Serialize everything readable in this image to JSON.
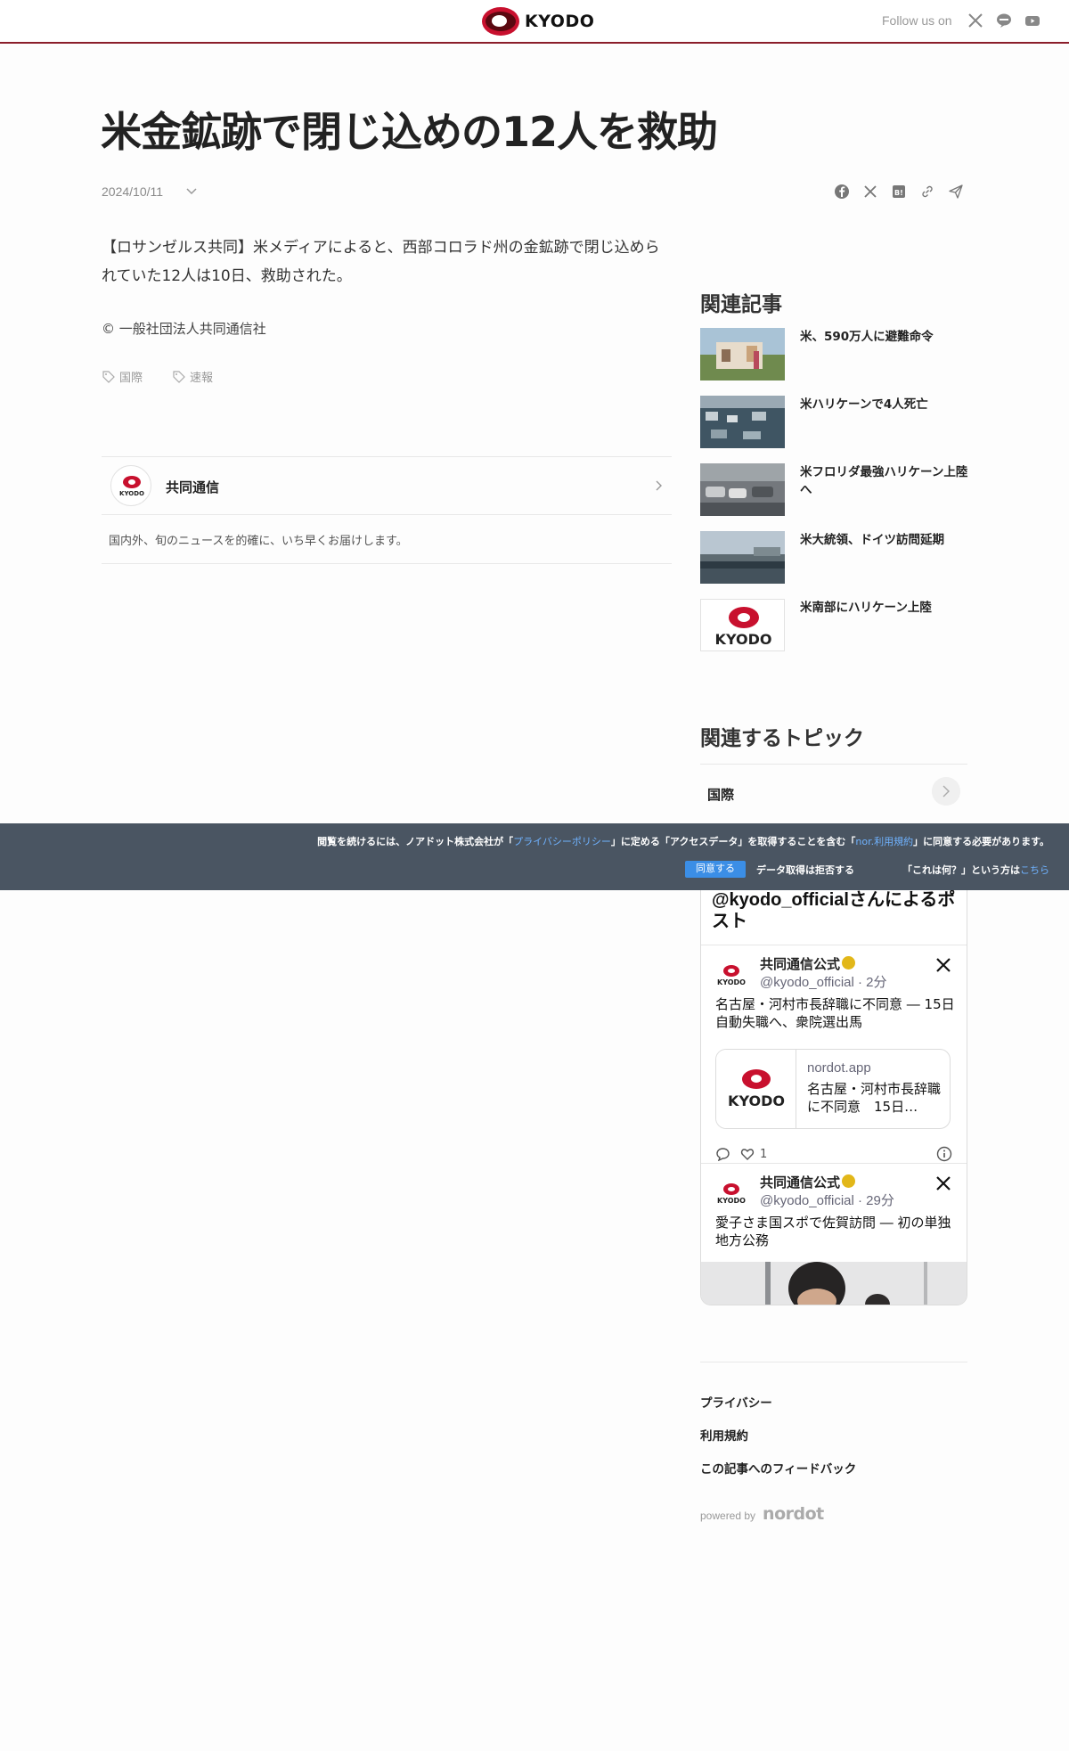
{
  "header": {
    "brand": "KYODO",
    "follow_label": "Follow us on",
    "social_icons": [
      "x-icon",
      "line-icon",
      "youtube-icon"
    ]
  },
  "article": {
    "title": "米金鉱跡で閉じ込めの12人を救助",
    "date": "2024/10/11",
    "share_icons": [
      "facebook-icon",
      "x-icon",
      "hatena-bookmark-icon",
      "link-icon",
      "send-icon"
    ],
    "body": "【ロサンゼルス共同】米メディアによると、西部コロラド州の金鉱跡で閉じ込められていた12人は10日、救助された。",
    "copyright": "© 一般社団法人共同通信社",
    "tags": [
      "国際",
      "速報"
    ]
  },
  "publisher": {
    "avatar_text": "KYODO",
    "name": "共同通信",
    "description": "国内外、旬のニュースを的確に、いち早くお届けします。"
  },
  "related": {
    "heading": "関連記事",
    "items": [
      {
        "title": "米、590万人に避難命令"
      },
      {
        "title": "米ハリケーンで4人死亡"
      },
      {
        "title": "米フロリダ最強ハリケーン上陸へ"
      },
      {
        "title": "米大統領、ドイツ訪問延期"
      },
      {
        "title": "米南部にハリケーン上陸",
        "thumb_text": "KYODO"
      }
    ]
  },
  "topics": {
    "heading": "関連するトピック",
    "items": [
      {
        "label": "国際"
      }
    ]
  },
  "consent": {
    "text_a": "閲覧を続けるには、ノアドット株式会社が「",
    "link_privacy": "プライバシーポリシー",
    "text_b": "」に定める「アクセスデータ」を取得することを含む「",
    "link_terms": "nor.利用規約",
    "text_c": "」に同意する必要があります。",
    "agree": "同意する",
    "decline": "データ取得は拒否する",
    "whatsthis": "「これは何？」という方は",
    "here": "こちら",
    "colors": {
      "background": "#4a5562",
      "button": "#3b8ee6",
      "link": "#6fb2ff"
    }
  },
  "twitter": {
    "heading": "@kyodo_officialさんによるポスト",
    "tweets": [
      {
        "name": "共同通信公式",
        "handle": "@kyodo_official · 2分",
        "avatar_text": "KYODO",
        "text": "名古屋・河村市長辞職に不同意 ― 15日自動失職へ、衆院選出馬",
        "card_domain": "nordot.app",
        "card_title": "名古屋・河村市長辞職に不同意　15日…",
        "card_text": "KYODO",
        "likes": "1"
      },
      {
        "name": "共同通信公式",
        "handle": "@kyodo_official · 29分",
        "avatar_text": "KYODO",
        "text": "愛子さま国スポで佐賀訪問 ― 初の単独地方公務"
      }
    ]
  },
  "footer": {
    "links": [
      "プライバシー",
      "利用規約",
      "この記事へのフィードバック"
    ],
    "powered_by": "powered by",
    "nordot": "nordot"
  }
}
